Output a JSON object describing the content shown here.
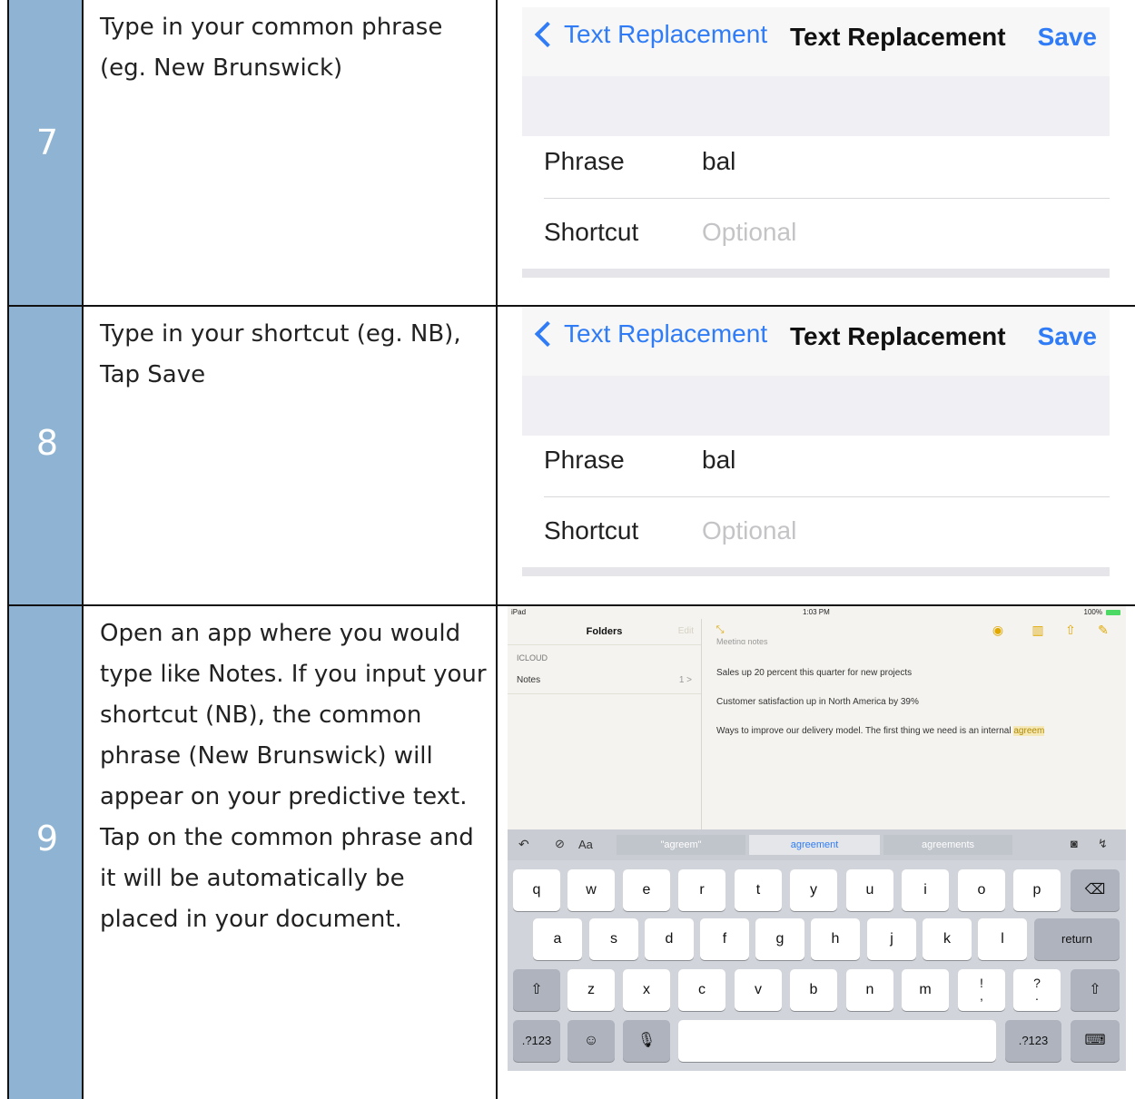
{
  "rows": [
    {
      "number": "7",
      "instruction": "Type in your common phrase (eg. New Brunswick)",
      "screen": {
        "back_label": "Text Replacement",
        "title": "Text Replacement",
        "save_label": "Save",
        "phrase_label": "Phrase",
        "phrase_value": "bal",
        "shortcut_label": "Shortcut",
        "shortcut_placeholder": "Optional"
      }
    },
    {
      "number": "8",
      "instruction": "Type in your shortcut (eg. NB), Tap Save",
      "screen": {
        "back_label": "Text Replacement",
        "title": "Text Replacement",
        "save_label": "Save",
        "phrase_label": "Phrase",
        "phrase_value": "bal",
        "shortcut_label": "Shortcut",
        "shortcut_placeholder": "Optional"
      }
    },
    {
      "number": "9",
      "instruction": "Open an app where you would type like Notes. If you input your shortcut (NB), the common phrase (New Brunswick) will appear on your predictive text. Tap on the common phrase and it will be automatically be placed in your document."
    }
  ],
  "ipad": {
    "status": {
      "device": "iPad",
      "time": "1:03 PM",
      "battery": "100%"
    },
    "sidebar": {
      "title": "Folders",
      "edit": "Edit",
      "section": "ICLOUD",
      "folder_name": "Notes",
      "folder_count": "1 >"
    },
    "note": {
      "heading": "Meeting notes",
      "lines": [
        "Sales up 20 percent this quarter for new projects",
        "Customer satisfaction up in North America by 39%",
        "Ways to improve our delivery model. The first thing we need is an internal "
      ],
      "highlight": "agreem"
    },
    "suggestions": [
      "\"agreem\"",
      "agreement",
      "agreements"
    ],
    "toolbar_left": [
      "undo-icon",
      "check-icon",
      "Aa"
    ],
    "keys": {
      "row1": [
        "q",
        "w",
        "e",
        "r",
        "t",
        "y",
        "u",
        "i",
        "o",
        "p"
      ],
      "row2": [
        "a",
        "s",
        "d",
        "f",
        "g",
        "h",
        "j",
        "k",
        "l"
      ],
      "row3": [
        "z",
        "x",
        "c",
        "v",
        "b",
        "n",
        "m",
        "!\n,",
        "?\n."
      ],
      "return": "return",
      "num1": ".?123",
      "num2": ".?123"
    },
    "colors": {
      "accent": "#e0a800",
      "keyboard": "#d1d5db"
    }
  },
  "colors": {
    "number_cell": "#8fb4d3",
    "ios_blue": "#2f7cf6"
  }
}
